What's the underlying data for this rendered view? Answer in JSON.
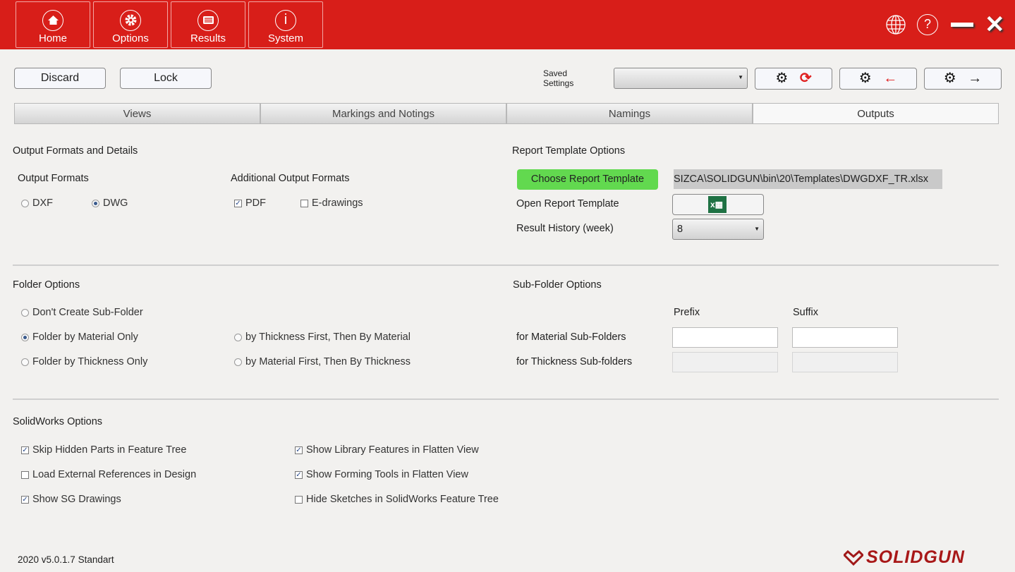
{
  "header": {
    "nav": [
      {
        "label": "Home",
        "icon": "home-icon"
      },
      {
        "label": "Options",
        "icon": "gear-icon"
      },
      {
        "label": "Results",
        "icon": "list-icon"
      },
      {
        "label": "System",
        "icon": "info-icon"
      }
    ],
    "right_icons": [
      "globe-icon",
      "help-icon",
      "minimize-icon",
      "close-icon"
    ],
    "color": "#d81e19"
  },
  "toolbar": {
    "discard": "Discard",
    "lock": "Lock",
    "saved_settings_label": "Saved Settings",
    "saved_settings_value": ""
  },
  "tabs": [
    {
      "label": "Views"
    },
    {
      "label": "Markings and Notings"
    },
    {
      "label": "Namings"
    },
    {
      "label": "Outputs",
      "active": true
    }
  ],
  "output": {
    "title": "Output Formats and Details",
    "formats_label": "Output Formats",
    "dxf": "DXF",
    "dwg": "DWG",
    "selected": "DWG",
    "additional_label": "Additional Output Formats",
    "pdf": "PDF",
    "pdf_checked": true,
    "edrawings": "E-drawings",
    "edrawings_checked": false
  },
  "report": {
    "title": "Report Template Options",
    "choose": "Choose Report Template",
    "path": "SIZCA\\SOLIDGUN\\bin\\20\\Templates\\DWGDXF_TR.xlsx",
    "open_label": "Open Report Template",
    "history_label": "Result History (week)",
    "history_value": "8"
  },
  "folder": {
    "title": "Folder Options",
    "opts": [
      "Don't Create Sub-Folder",
      "Folder by Material Only",
      "Folder by Thickness Only",
      "by Thickness First, Then By Material",
      "by Material First, Then By Thickness"
    ],
    "selected": "Folder by Material Only"
  },
  "subfolder": {
    "title": "Sub-Folder Options",
    "prefix": "Prefix",
    "suffix": "Suffix",
    "material": "for Material Sub-Folders",
    "thickness": "for Thickness Sub-folders"
  },
  "solidworks": {
    "title": "SolidWorks Options",
    "items": [
      {
        "label": "Skip Hidden Parts in Feature Tree",
        "checked": true
      },
      {
        "label": "Load External References in Design",
        "checked": false
      },
      {
        "label": "Show SG Drawings",
        "checked": true
      },
      {
        "label": "Show Library Features in Flatten View",
        "checked": true
      },
      {
        "label": "Show Forming Tools in Flatten View",
        "checked": true
      },
      {
        "label": "Hide Sketches in SolidWorks Feature Tree",
        "checked": false
      }
    ]
  },
  "footer": {
    "version": "2020 v5.0.1.7 Standart",
    "logo": "SOLIDGUN"
  }
}
